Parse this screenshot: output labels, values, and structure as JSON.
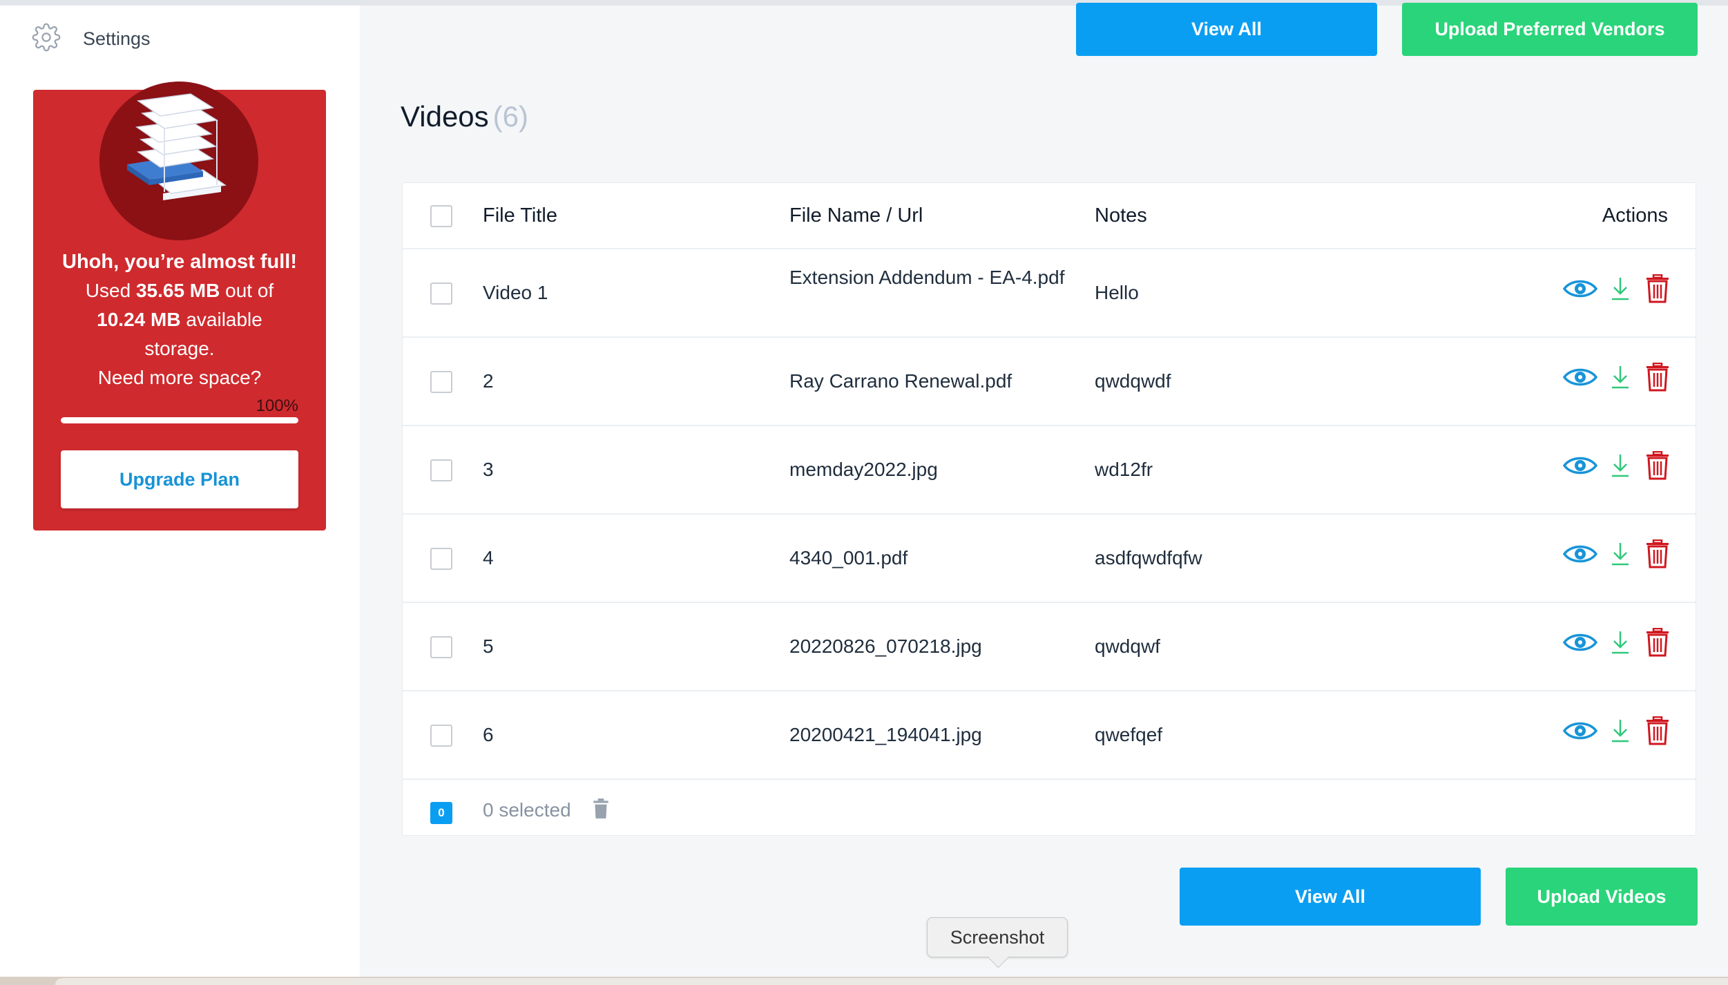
{
  "sidebar": {
    "settings_label": "Settings",
    "storage": {
      "headline": "Uhoh, you’re almost full!",
      "used_prefix": "Used ",
      "used_amount": "35.65 MB",
      "used_mid": " out of",
      "total_amount": "10.24 MB",
      "total_suffix": " available",
      "storage_word": "storage.",
      "need_more": "Need more space?",
      "percent_label": "100%",
      "percent_value": 100,
      "upgrade_label": "Upgrade Plan"
    }
  },
  "top_buttons": {
    "view_all_label": "View All",
    "upload_vendors_label": "Upload Preferred Vendors"
  },
  "section": {
    "title": "Videos",
    "count": "(6)"
  },
  "table": {
    "headers": {
      "title": "File Title",
      "file": "File Name / Url",
      "notes": "Notes",
      "actions": "Actions"
    },
    "rows": [
      {
        "title": "Video 1",
        "file": "Extension Addendum - EA-4.pdf",
        "notes": "Hello"
      },
      {
        "title": "2",
        "file": "Ray Carrano Renewal.pdf",
        "notes": "qwdqwdf"
      },
      {
        "title": "3",
        "file": "memday2022.jpg",
        "notes": "wd12fr"
      },
      {
        "title": "4",
        "file": "4340_001.pdf",
        "notes": "asdfqwdfqfw"
      },
      {
        "title": "5",
        "file": "20220826_070218.jpg",
        "notes": "qwdqwf"
      },
      {
        "title": "6",
        "file": "20200421_194041.jpg",
        "notes": "qwefqef"
      }
    ],
    "footer": {
      "selected_count": "0",
      "selected_label": "0 selected"
    }
  },
  "bottom_buttons": {
    "view_all_label": "View All",
    "upload_videos_label": "Upload Videos"
  },
  "tooltip": {
    "label": "Screenshot"
  },
  "colors": {
    "accent_blue": "#0a9ef2",
    "accent_green": "#2ad47a",
    "alert_red": "#cf2a2e",
    "download_green": "#2ec87a",
    "trash_red": "#d0171f"
  },
  "icons": {
    "settings": "gear-icon",
    "view": "eye-icon",
    "download": "download-icon",
    "delete": "trash-icon"
  }
}
